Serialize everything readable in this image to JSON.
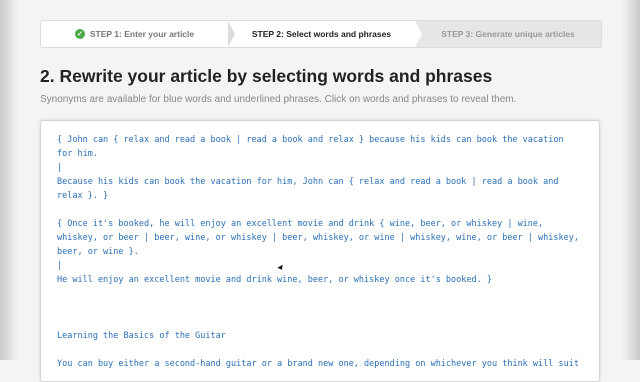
{
  "steps": [
    {
      "label": "STEP 1: Enter your article"
    },
    {
      "label": "STEP 2: Select words and phrases"
    },
    {
      "label": "STEP 3: Generate unique articles"
    }
  ],
  "heading": "2. Rewrite your article by selecting words and phrases",
  "subheading": "Synonyms are available for blue words and underlined phrases. Click on words and phrases to reveal them.",
  "editor": {
    "lines": [
      "{ John can { relax and read a book | read a book and relax } because his kids can book the vacation",
      "for him.",
      "|",
      "Because his kids can book the vacation for him, John can { relax and read a book | read a book and",
      "relax }. }",
      "",
      "{ Once it's booked, he will enjoy an excellent movie and drink { wine, beer, or whiskey | wine,",
      "whiskey, or beer | beer, wine, or whiskey | beer, whiskey, or wine | whiskey, wine, or beer | whiskey,",
      "beer, or wine }.",
      "|",
      "He will enjoy an excellent movie and drink wine, beer, or whiskey once it's booked. }",
      "",
      "",
      "",
      "Learning the Basics of the Guitar",
      "",
      "You can buy either a second-hand guitar or a brand new one, depending on whichever you think will suit"
    ]
  },
  "icons": {
    "step_check": "check-circle-icon",
    "cursor": "mouse-pointer-icon"
  },
  "colors": {
    "accent_blue": "#2a6fb5",
    "check_green": "#4caa4a"
  }
}
